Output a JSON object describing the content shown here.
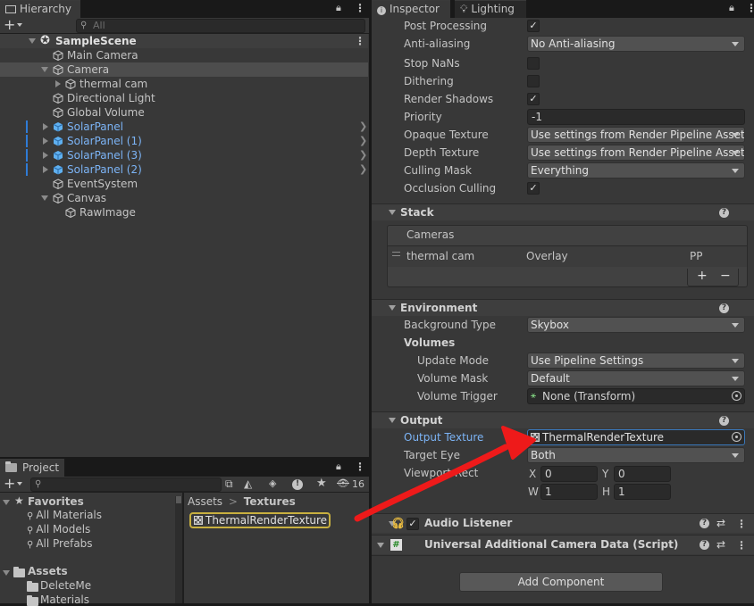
{
  "hierarchy": {
    "tab_label": "Hierarchy",
    "search_placeholder": "All",
    "scene_name": "SampleScene",
    "items": [
      {
        "label": "Main Camera"
      },
      {
        "label": "Camera"
      },
      {
        "label": "thermal cam"
      },
      {
        "label": "Directional Light"
      },
      {
        "label": "Global Volume"
      },
      {
        "label": "SolarPanel"
      },
      {
        "label": "SolarPanel (1)"
      },
      {
        "label": "SolarPanel (3)"
      },
      {
        "label": "SolarPanel (2)"
      },
      {
        "label": "EventSystem"
      },
      {
        "label": "Canvas"
      },
      {
        "label": "RawImage"
      }
    ]
  },
  "project": {
    "tab_label": "Project",
    "hidden_count": "16",
    "favorites_label": "Favorites",
    "favorites": [
      "All Materials",
      "All Models",
      "All Prefabs"
    ],
    "assets_label": "Assets",
    "folders": [
      "DeleteMe",
      "Materials"
    ],
    "breadcrumb": {
      "root": "Assets",
      "sep": ">",
      "current": "Textures"
    },
    "asset_item": "ThermalRenderTexture"
  },
  "inspector": {
    "tab_label": "Inspector",
    "lighting_tab_label": "Lighting",
    "post_processing": "Post Processing",
    "anti_aliasing_label": "Anti-aliasing",
    "anti_aliasing_value": "No Anti-aliasing",
    "stop_nans": "Stop NaNs",
    "dithering": "Dithering",
    "render_shadows": "Render Shadows",
    "priority_label": "Priority",
    "priority_value": "-1",
    "opaque_texture_label": "Opaque Texture",
    "opaque_texture_value": "Use settings from Render Pipeline Asset",
    "depth_texture_label": "Depth Texture",
    "depth_texture_value": "Use settings from Render Pipeline Asset",
    "culling_mask_label": "Culling Mask",
    "culling_mask_value": "Everything",
    "occlusion_culling": "Occlusion Culling",
    "check_mark": "✓",
    "stack_section": "Stack",
    "cameras_header": "Cameras",
    "stack_camera_name": "thermal cam",
    "stack_camera_type": "Overlay",
    "stack_camera_pp": "PP",
    "plus_label": "+",
    "minus_label": "−",
    "environment_section": "Environment",
    "background_type_label": "Background Type",
    "background_type_value": "Skybox",
    "volumes_label": "Volumes",
    "update_mode_label": "Update Mode",
    "update_mode_value": "Use Pipeline Settings",
    "volume_mask_label": "Volume Mask",
    "volume_mask_value": "Default",
    "volume_trigger_label": "Volume Trigger",
    "volume_trigger_value": "None (Transform)",
    "output_section": "Output",
    "output_texture_label": "Output Texture",
    "output_texture_value": "ThermalRenderTexture",
    "target_eye_label": "Target Eye",
    "target_eye_value": "Both",
    "viewport_label": "Viewport Rect",
    "x_label": "X",
    "x_value": "0",
    "y_label": "Y",
    "y_value": "0",
    "w_label": "W",
    "w_value": "1",
    "h_label": "H",
    "h_value": "1",
    "audio_listener": "Audio Listener",
    "urp_script": "Universal Additional Camera Data (Script)",
    "add_component": "Add Component"
  },
  "colors": {
    "selection": "#2f7bd6",
    "arrow": "#ee1a1a",
    "highlight": "#c8b040"
  }
}
